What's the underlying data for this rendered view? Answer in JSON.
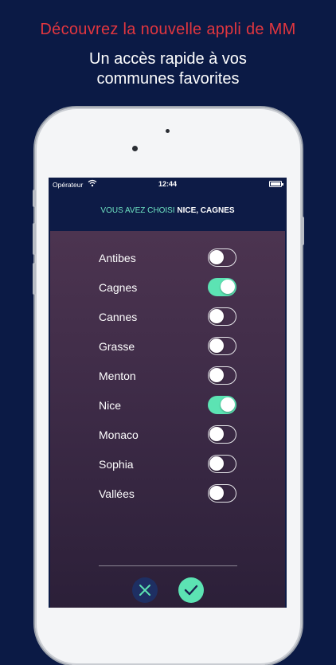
{
  "promo": {
    "headline": "Découvrez la nouvelle appli de MM",
    "subline_1": "Un accès rapide à vos",
    "subline_2": "communes favorites"
  },
  "statusbar": {
    "carrier": "Opérateur",
    "time": "12:44",
    "wifi_icon": "wifi-icon",
    "battery_icon": "battery-icon"
  },
  "selection": {
    "prefix": "VOUS AVEZ CHOISI",
    "cities": "NICE, CAGNES"
  },
  "communes": [
    {
      "name": "Antibes",
      "selected": false
    },
    {
      "name": "Cagnes",
      "selected": true
    },
    {
      "name": "Cannes",
      "selected": false
    },
    {
      "name": "Grasse",
      "selected": false
    },
    {
      "name": "Menton",
      "selected": false
    },
    {
      "name": "Nice",
      "selected": true
    },
    {
      "name": "Monaco",
      "selected": false
    },
    {
      "name": "Sophia",
      "selected": false
    },
    {
      "name": "Vallées",
      "selected": false
    }
  ],
  "actions": {
    "cancel_icon": "close-icon",
    "confirm_icon": "check-icon"
  },
  "colors": {
    "background": "#0b1a45",
    "headline": "#e2363f",
    "accent": "#5ce3b3"
  }
}
